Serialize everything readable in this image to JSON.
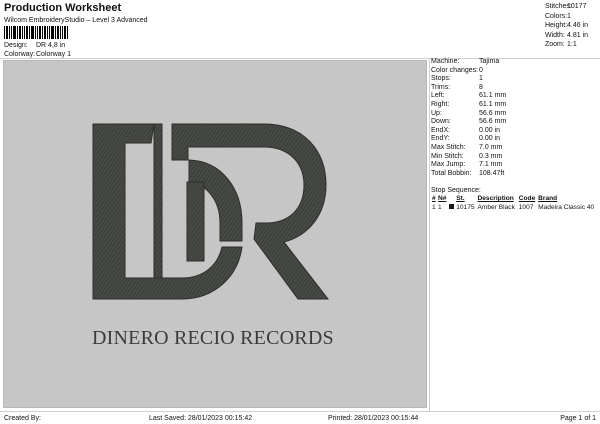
{
  "header": {
    "title": "Production Worksheet",
    "subtitle": "Wilcom EmbroideryStudio – Level 3 Advanced",
    "design_label": "Design:",
    "design_value": "DR 4,8 in",
    "colorway_label": "Colorway:",
    "colorway_value": "Colorway 1"
  },
  "stats": [
    {
      "label": "Stitches:",
      "value": "10177"
    },
    {
      "label": "Colors:",
      "value": "1"
    },
    {
      "label": "Height:",
      "value": "4.46 in"
    },
    {
      "label": "Width:",
      "value": "4.81 in"
    },
    {
      "label": "Zoom:",
      "value": "1:1"
    }
  ],
  "design_preview": {
    "text": "DINERO RECIO RECORDS",
    "thread_color": "#474a45",
    "background_color": "#c6c6c6"
  },
  "machine_info": [
    {
      "label": "Machine:",
      "value": "Tajima"
    },
    {
      "label": "Color changes:",
      "value": "0"
    },
    {
      "label": "Stops:",
      "value": "1"
    },
    {
      "label": "Trims:",
      "value": "8"
    },
    {
      "label": "Left:",
      "value": "61.1 mm"
    },
    {
      "label": "Right:",
      "value": "61.1 mm"
    },
    {
      "label": "Up:",
      "value": "56.6 mm"
    },
    {
      "label": "Down:",
      "value": "56.6 mm"
    },
    {
      "label": "EndX:",
      "value": "0.00 in"
    },
    {
      "label": "EndY:",
      "value": "0.00 in"
    },
    {
      "label": "Max Stitch:",
      "value": "7.0 mm"
    },
    {
      "label": "Min Stitch:",
      "value": "0.3 mm"
    },
    {
      "label": "Max Jump:",
      "value": "7.1 mm"
    },
    {
      "label": "Total Bobbin:",
      "value": "108.47ft"
    }
  ],
  "stop_sequence": {
    "title": "Stop Sequence:",
    "columns": [
      "#",
      "N#",
      "",
      "St.",
      "Description",
      "Code",
      "Brand"
    ],
    "rows": [
      {
        "num": "1",
        "n": "1",
        "swatch": "#1a1a1a",
        "st": "10175",
        "description": "Amber Black",
        "code": "1007",
        "brand": "Madeira Classic 40"
      }
    ]
  },
  "footer": {
    "created_by": "Created By:",
    "last_saved": "Last Saved: 28/01/2023 00:15:42",
    "printed": "Printed: 28/01/2023 00:15:44",
    "page": "Page 1 of 1"
  }
}
